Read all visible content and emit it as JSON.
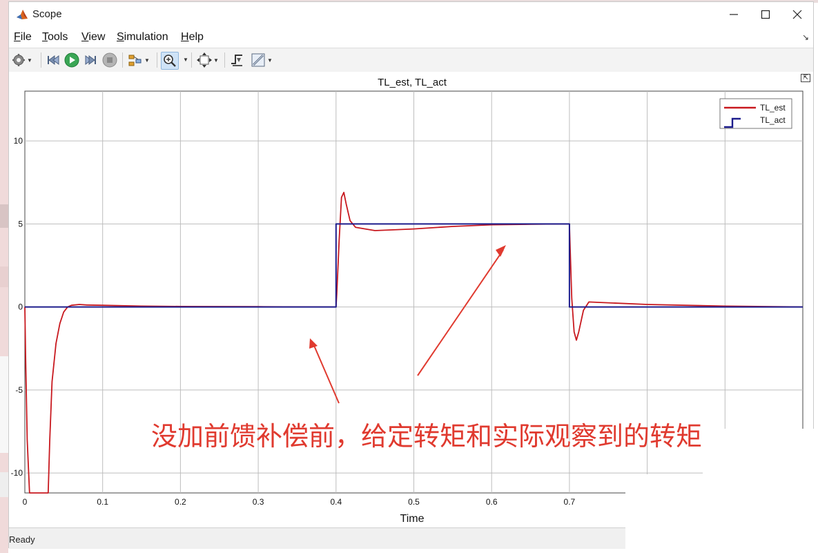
{
  "window": {
    "title": "Scope",
    "controls": [
      "minimize-icon",
      "maximize-icon",
      "close-icon"
    ]
  },
  "menu": {
    "items": [
      {
        "label": "File",
        "mnemonic": "F",
        "rest": "ile"
      },
      {
        "label": "Tools",
        "mnemonic": "T",
        "rest": "ools"
      },
      {
        "label": "View",
        "mnemonic": "V",
        "rest": "iew"
      },
      {
        "label": "Simulation",
        "mnemonic": "S",
        "rest": "imulation"
      },
      {
        "label": "Help",
        "mnemonic": "H",
        "rest": "elp"
      }
    ]
  },
  "toolbar": {
    "icons": [
      "settings-icon",
      "step-back-icon",
      "run-icon",
      "step-forward-icon",
      "stop-icon",
      "highlight-icon",
      "zoom-in-icon",
      "fit-view-icon",
      "trigger-icon",
      "measure-icon"
    ]
  },
  "annotation": {
    "text": "没加前馈补偿前，给定转矩和实际观察到的转矩",
    "color": "#e03a2f"
  },
  "status": {
    "text": "Ready"
  },
  "colors": {
    "est": "#c8181e",
    "act": "#1c1c8c",
    "grid": "#bdbdbd"
  },
  "chart_data": {
    "type": "line",
    "title": "TL_est, TL_act",
    "xlabel": "Time",
    "ylabel": "",
    "xlim": [
      0,
      1
    ],
    "ylim": [
      -11.2,
      13
    ],
    "xticks": [
      0,
      0.1,
      0.2,
      0.3,
      0.4,
      0.5,
      0.6,
      0.7
    ],
    "xtick_labels": [
      "0",
      "0.1",
      "0.2",
      "0.3",
      "0.4",
      "0.5",
      "0.6",
      "0.7"
    ],
    "yticks": [
      -10,
      -5,
      0,
      5,
      10
    ],
    "ytick_labels": [
      "-10",
      "-5",
      "0",
      "5",
      "10"
    ],
    "grid": true,
    "legend": "top-right",
    "series": [
      {
        "name": "TL_est",
        "style": "line",
        "color": "#c8181e",
        "x": [
          0,
          0.001,
          0.003,
          0.006,
          0.01,
          0.02,
          0.03,
          0.032,
          0.035,
          0.04,
          0.045,
          0.05,
          0.055,
          0.06,
          0.07,
          0.08,
          0.1,
          0.15,
          0.2,
          0.3,
          0.39,
          0.4,
          0.401,
          0.404,
          0.407,
          0.41,
          0.413,
          0.418,
          0.425,
          0.45,
          0.5,
          0.55,
          0.6,
          0.65,
          0.69,
          0.7,
          0.701,
          0.703,
          0.706,
          0.709,
          0.712,
          0.718,
          0.725,
          0.75,
          0.8,
          0.9,
          1.0
        ],
        "y": [
          0,
          -3,
          -8,
          -11.2,
          -11.2,
          -11.2,
          -11.2,
          -8,
          -4.5,
          -2.2,
          -1.0,
          -0.3,
          0.0,
          0.1,
          0.15,
          0.12,
          0.1,
          0.05,
          0.03,
          0.02,
          0.0,
          0.0,
          0.8,
          4.0,
          6.6,
          6.9,
          6.2,
          5.2,
          4.8,
          4.6,
          4.7,
          4.85,
          4.95,
          4.98,
          5.0,
          5.0,
          3.5,
          0.5,
          -1.5,
          -2.0,
          -1.5,
          -0.2,
          0.3,
          0.25,
          0.15,
          0.05,
          0.0
        ]
      },
      {
        "name": "TL_act",
        "style": "step",
        "color": "#1c1c8c",
        "x": [
          0,
          0.4,
          0.4,
          0.7,
          0.7,
          1.0
        ],
        "y": [
          0,
          0,
          5,
          5,
          0,
          0
        ]
      }
    ]
  }
}
